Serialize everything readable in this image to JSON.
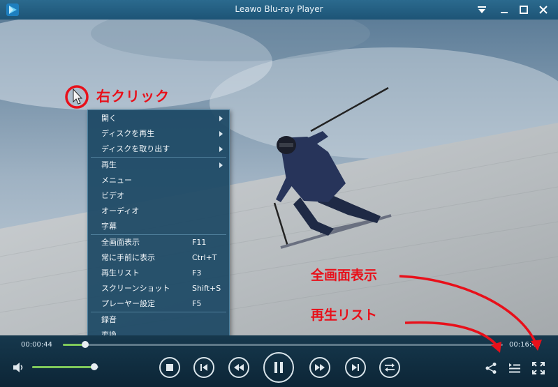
{
  "window": {
    "title": "Leawo Blu-ray Player"
  },
  "context_menu": {
    "groups": [
      [
        {
          "label": "開く",
          "submenu": true
        },
        {
          "label": "ディスクを再生",
          "submenu": true
        },
        {
          "label": "ディスクを取り出す",
          "submenu": true
        }
      ],
      [
        {
          "label": "再生",
          "submenu": true
        },
        {
          "label": "メニュー"
        },
        {
          "label": "ビデオ"
        },
        {
          "label": "オーディオ"
        },
        {
          "label": "字幕"
        }
      ],
      [
        {
          "label": "全画面表示",
          "shortcut": "F11"
        },
        {
          "label": "常に手前に表示",
          "shortcut": "Ctrl+T"
        },
        {
          "label": "再生リスト",
          "shortcut": "F3"
        },
        {
          "label": "スクリーンショット",
          "shortcut": "Shift+S"
        },
        {
          "label": "プレーヤー設定",
          "shortcut": "F5"
        }
      ],
      [
        {
          "label": "録音"
        },
        {
          "label": "変換"
        }
      ]
    ]
  },
  "annotations": {
    "right_click": "右クリック",
    "fullscreen": "全画面表示",
    "playlist": "再生リスト"
  },
  "playback": {
    "current_time": "00:00:44",
    "total_time": "00:16:45",
    "progress": 0.051,
    "volume": 0.94
  },
  "icons": {
    "app": "app-logo-icon",
    "dropdown": "triangle-down-icon",
    "minimize": "minimize-icon",
    "maximize": "maximize-icon",
    "close": "close-icon",
    "cursor": "mouse-pointer-icon",
    "volume": "speaker-icon",
    "stop": "stop-icon",
    "previous": "skip-previous-icon",
    "rewind": "rewind-icon",
    "pause": "pause-icon",
    "fast_forward": "fast-forward-icon",
    "next": "skip-next-icon",
    "loop": "repeat-icon",
    "share": "share-icon",
    "playlist": "playlist-icon",
    "fullscreen": "fullscreen-icon"
  },
  "colors": {
    "annotation": "#e8101a",
    "progress_fill": "#7fc95a",
    "menu_bg": "#1c4864",
    "titlebar": "#235f82"
  }
}
